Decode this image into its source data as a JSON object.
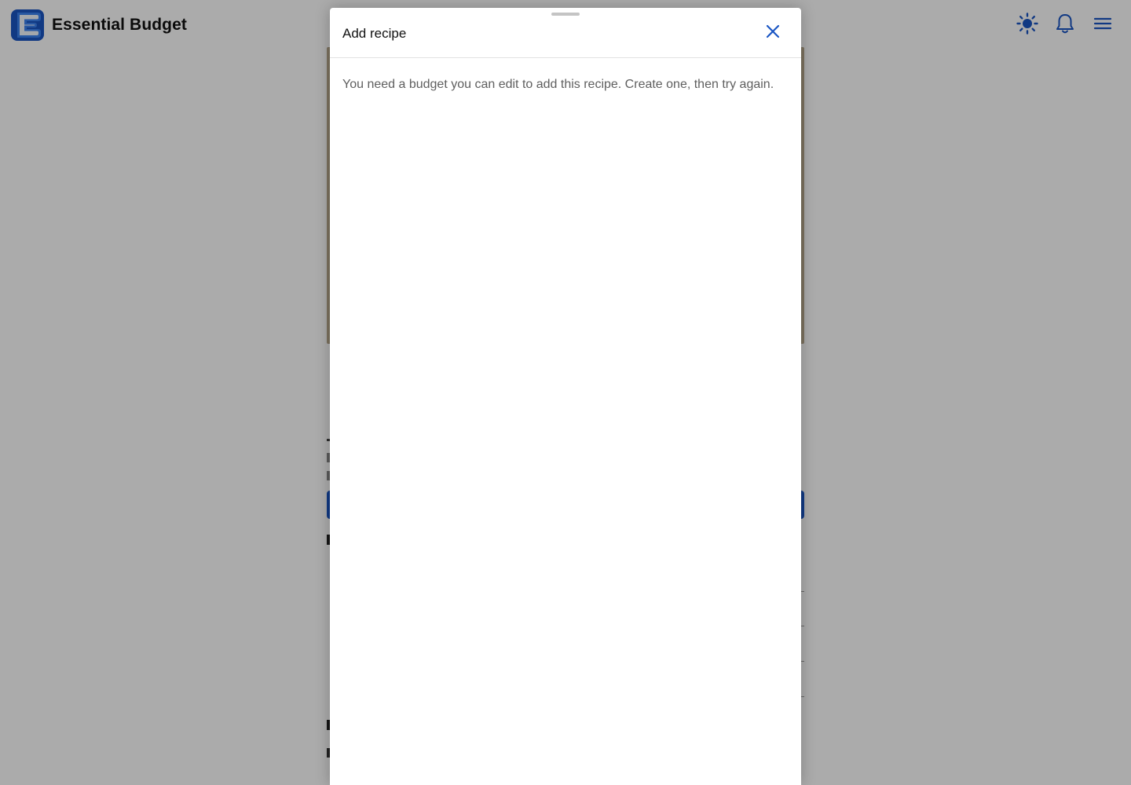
{
  "header": {
    "app_title": "Essential Budget",
    "logo_letter": "E",
    "icons": [
      "sun-icon",
      "bell-icon",
      "menu-icon"
    ]
  },
  "dialog": {
    "title": "Add recipe",
    "message": "You need a budget you can edit to add this recipe. Create one, then try again."
  },
  "colors": {
    "accent": "#1a56c4",
    "scrim": "rgba(0,0,0,0.33)",
    "text_primary": "#111111",
    "text_secondary": "#5f5f5f"
  }
}
